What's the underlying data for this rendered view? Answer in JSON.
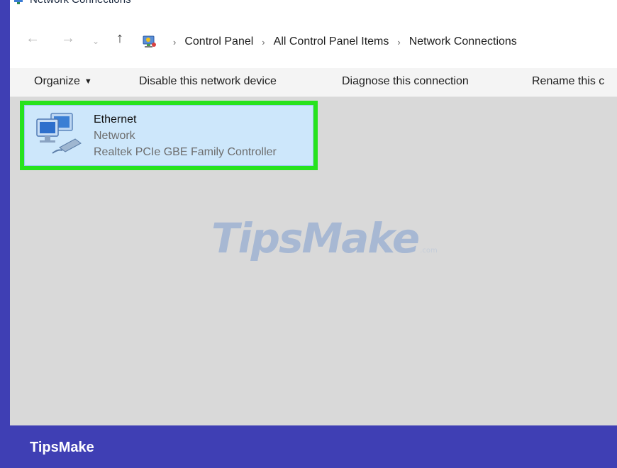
{
  "window": {
    "title": "Network Connections"
  },
  "address_bar": {
    "back_icon": "arrow-left",
    "forward_icon": "arrow-right",
    "recent_icon": "chevron-down",
    "up_icon": "arrow-up",
    "location_icon": "control-panel-icon",
    "breadcrumbs": [
      "Control Panel",
      "All Control Panel Items",
      "Network Connections"
    ],
    "separator": "›"
  },
  "toolbar": {
    "organize_label": "Organize",
    "disable_label": "Disable this network device",
    "diagnose_label": "Diagnose this connection",
    "rename_label": "Rename this c"
  },
  "connection": {
    "name": "Ethernet",
    "type": "Network",
    "adapter": "Realtek PCIe GBE Family Controller",
    "icon": "network-adapter-icon",
    "highlight_color": "#27e31d"
  },
  "watermark": {
    "text": "TipsMake",
    "suffix": ".com"
  },
  "footer": {
    "brand": "TipsMake",
    "background_color": "#3f3fb4"
  }
}
